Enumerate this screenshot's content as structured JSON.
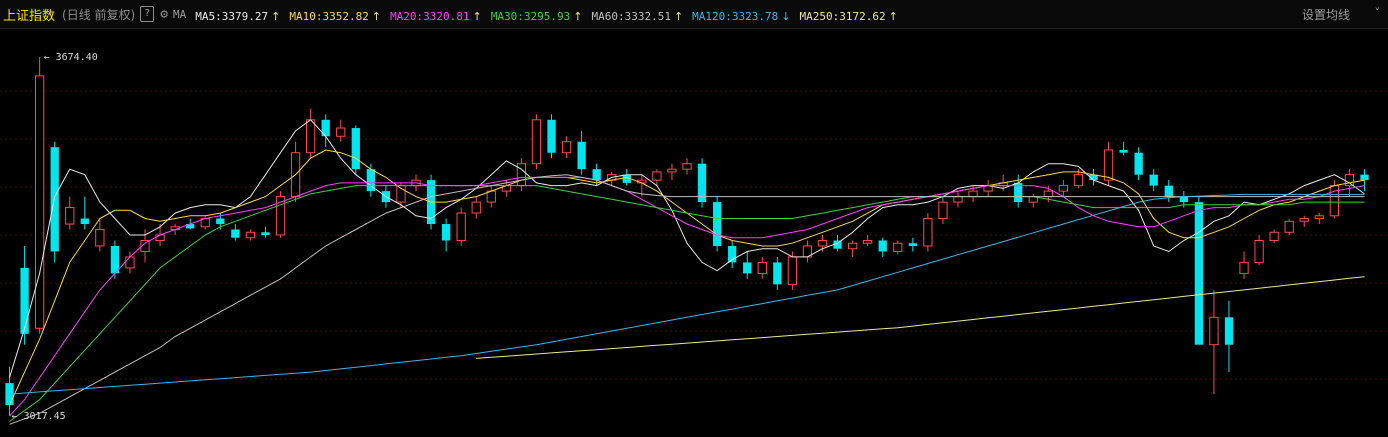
{
  "header": {
    "title": "上证指数",
    "period": "(日线 前复权)",
    "help_label": "?",
    "ma_label": "MA",
    "settings_label": "设置均线",
    "chevron": "˅"
  },
  "moving_averages": [
    {
      "label": "MA5:3379.27",
      "arrow": "↑",
      "color": "#e8e8e8"
    },
    {
      "label": "MA10:3352.82",
      "arrow": "↑",
      "color": "#ffd83a"
    },
    {
      "label": "MA20:3320.81",
      "arrow": "↑",
      "color": "#ff3cff"
    },
    {
      "label": "MA30:3295.93",
      "arrow": "↑",
      "color": "#3cd23c"
    },
    {
      "label": "MA60:3332.51",
      "arrow": "↑",
      "color": "#bfbfbf"
    },
    {
      "label": "MA120:3323.78",
      "arrow": "↓",
      "color": "#3cb4e6"
    },
    {
      "label": "MA250:3172.62",
      "arrow": "↑",
      "color": "#e8e890"
    }
  ],
  "chart_data": {
    "type": "candlestick",
    "colors": {
      "up": "#ff4a4a",
      "down": "#00e5ee"
    },
    "annotations": {
      "high": "3674.40",
      "low": "3017.45"
    },
    "series": [
      {
        "name": "MA5",
        "values": [
          3090,
          3180,
          3280,
          3420,
          3470,
          3460,
          3410,
          3380,
          3350,
          3350,
          3365,
          3390,
          3400,
          3405,
          3405,
          3400,
          3420,
          3460,
          3500,
          3540,
          3560,
          3530,
          3490,
          3460,
          3440,
          3420,
          3405,
          3385,
          3380,
          3400,
          3415,
          3435,
          3460,
          3485,
          3470,
          3445,
          3440,
          3440,
          3445,
          3440,
          3455,
          3460,
          3460,
          3440,
          3395,
          3335,
          3300,
          3285,
          3305,
          3320,
          3325,
          3325,
          3310,
          3310,
          3325,
          3335,
          3355,
          3380,
          3400,
          3405,
          3405,
          3410,
          3420,
          3435,
          3440,
          3440,
          3435,
          3445,
          3465,
          3480,
          3480,
          3475,
          3450,
          3440,
          3430,
          3395,
          3330,
          3320,
          3340,
          3355,
          3375,
          3385,
          3410,
          3405,
          3415,
          3425,
          3440,
          3450,
          3460,
          3445,
          3425
        ]
      },
      {
        "name": "MA10",
        "values": [
          3040,
          3100,
          3160,
          3230,
          3300,
          3340,
          3380,
          3395,
          3395,
          3380,
          3375,
          3380,
          3385,
          3385,
          3390,
          3400,
          3410,
          3420,
          3440,
          3460,
          3490,
          3505,
          3500,
          3490,
          3470,
          3455,
          3435,
          3420,
          3410,
          3410,
          3415,
          3420,
          3430,
          3440,
          3450,
          3455,
          3455,
          3455,
          3450,
          3445,
          3450,
          3455,
          3445,
          3430,
          3410,
          3390,
          3370,
          3350,
          3340,
          3335,
          3330,
          3330,
          3335,
          3345,
          3355,
          3365,
          3375,
          3390,
          3405,
          3410,
          3415,
          3420,
          3425,
          3430,
          3435,
          3440,
          3445,
          3450,
          3455,
          3460,
          3465,
          3465,
          3460,
          3455,
          3445,
          3425,
          3380,
          3355,
          3345,
          3345,
          3355,
          3365,
          3380,
          3395,
          3405,
          3410,
          3420,
          3430,
          3440,
          3445,
          3450
        ]
      },
      {
        "name": "MA20",
        "values": [
          3020,
          3050,
          3090,
          3130,
          3170,
          3210,
          3250,
          3280,
          3310,
          3335,
          3350,
          3360,
          3370,
          3380,
          3385,
          3390,
          3395,
          3400,
          3410,
          3420,
          3430,
          3440,
          3445,
          3445,
          3445,
          3445,
          3445,
          3445,
          3440,
          3440,
          3440,
          3440,
          3445,
          3450,
          3455,
          3455,
          3455,
          3455,
          3455,
          3450,
          3440,
          3430,
          3415,
          3400,
          3385,
          3370,
          3360,
          3350,
          3345,
          3345,
          3345,
          3350,
          3355,
          3360,
          3370,
          3380,
          3390,
          3400,
          3405,
          3410,
          3415,
          3420,
          3425,
          3430,
          3435,
          3440,
          3440,
          3440,
          3440,
          3435,
          3420,
          3400,
          3385,
          3375,
          3370,
          3365,
          3365,
          3375,
          3385,
          3395,
          3400,
          3400,
          3405,
          3405,
          3410,
          3415,
          3415,
          3420,
          3430,
          3435,
          3440
        ]
      },
      {
        "name": "MA30",
        "values": [
          3010,
          3030,
          3050,
          3080,
          3110,
          3140,
          3170,
          3200,
          3230,
          3260,
          3290,
          3310,
          3330,
          3350,
          3365,
          3375,
          3385,
          3395,
          3405,
          3415,
          3425,
          3430,
          3435,
          3440,
          3440,
          3440,
          3440,
          3440,
          3440,
          3440,
          3440,
          3440,
          3440,
          3440,
          3440,
          3440,
          3435,
          3430,
          3425,
          3420,
          3415,
          3410,
          3405,
          3400,
          3395,
          3390,
          3385,
          3380,
          3380,
          3380,
          3380,
          3380,
          3380,
          3385,
          3390,
          3395,
          3400,
          3405,
          3410,
          3415,
          3420,
          3420,
          3420,
          3420,
          3420,
          3420,
          3420,
          3420,
          3420,
          3415,
          3410,
          3405,
          3400,
          3400,
          3400,
          3400,
          3400,
          3400,
          3405,
          3405,
          3405,
          3405,
          3405,
          3405,
          3405,
          3405,
          3410,
          3410,
          3410,
          3410,
          3410
        ]
      },
      {
        "name": "MA60",
        "values": [
          3005,
          3015,
          3025,
          3040,
          3055,
          3070,
          3085,
          3100,
          3115,
          3130,
          3145,
          3165,
          3180,
          3195,
          3210,
          3225,
          3240,
          3255,
          3270,
          3290,
          3310,
          3330,
          3345,
          3360,
          3375,
          3390,
          3400,
          3410,
          3420,
          3425,
          3430,
          3435,
          3440,
          3445,
          3450,
          3455,
          3458,
          3460,
          3455,
          3450,
          3440,
          3430,
          3425,
          3422,
          3420,
          3420,
          3420,
          3420,
          3420,
          3420,
          3420,
          3420,
          3420,
          3420,
          3420,
          3420,
          3420,
          3420,
          3420,
          3420,
          3420,
          3420,
          3420,
          3420,
          3420,
          3420,
          3420,
          3420,
          3420,
          3420,
          3420,
          3420,
          3420,
          3420,
          3420,
          3420,
          3420,
          3420,
          3420,
          3420,
          3420,
          3420,
          3420,
          3420,
          3420,
          3420,
          3420,
          3420,
          3420,
          3420,
          3420
        ]
      },
      {
        "name": "MA120",
        "values": [
          3060,
          3062,
          3064,
          3066,
          3068,
          3070,
          3072,
          3074,
          3076,
          3078,
          3080,
          3082,
          3084,
          3086,
          3088,
          3090,
          3092,
          3094,
          3096,
          3098,
          3100,
          3103,
          3106,
          3109,
          3112,
          3115,
          3118,
          3121,
          3124,
          3127,
          3130,
          3134,
          3138,
          3142,
          3146,
          3150,
          3155,
          3160,
          3165,
          3170,
          3175,
          3180,
          3185,
          3190,
          3195,
          3200,
          3205,
          3210,
          3215,
          3220,
          3225,
          3230,
          3235,
          3240,
          3245,
          3250,
          3258,
          3266,
          3274,
          3282,
          3290,
          3298,
          3306,
          3314,
          3322,
          3330,
          3338,
          3346,
          3354,
          3362,
          3370,
          3378,
          3386,
          3394,
          3402,
          3410,
          3415,
          3418,
          3420,
          3421,
          3422,
          3423,
          3424,
          3424,
          3424,
          3424,
          3424,
          3424,
          3424,
          3424,
          3424
        ]
      },
      {
        "name": "MA250",
        "values": [
          null,
          null,
          null,
          null,
          null,
          null,
          null,
          null,
          null,
          null,
          null,
          null,
          null,
          null,
          null,
          null,
          null,
          null,
          null,
          null,
          null,
          null,
          null,
          null,
          null,
          null,
          null,
          null,
          null,
          null,
          null,
          3125,
          3127,
          3129,
          3131,
          3133,
          3135,
          3137,
          3139,
          3141,
          3143,
          3145,
          3147,
          3149,
          3151,
          3153,
          3155,
          3157,
          3159,
          3161,
          3163,
          3165,
          3167,
          3169,
          3171,
          3173,
          3175,
          3177,
          3179,
          3181,
          3184,
          3187,
          3190,
          3193,
          3196,
          3199,
          3202,
          3205,
          3208,
          3211,
          3214,
          3217,
          3220,
          3223,
          3226,
          3229,
          3232,
          3235,
          3238,
          3241,
          3244,
          3247,
          3250,
          3253,
          3256,
          3259,
          3262,
          3265,
          3268,
          3271,
          3274
        ]
      }
    ],
    "candles": [
      [
        3080,
        3110,
        3020,
        3040
      ],
      [
        3290,
        3330,
        3150,
        3170
      ],
      [
        3180,
        3674.4,
        3170,
        3640
      ],
      [
        3510,
        3520,
        3300,
        3320
      ],
      [
        3370,
        3420,
        3360,
        3400
      ],
      [
        3380,
        3420,
        3360,
        3370
      ],
      [
        3330,
        3380,
        3320,
        3360
      ],
      [
        3330,
        3340,
        3270,
        3280
      ],
      [
        3290,
        3320,
        3280,
        3310
      ],
      [
        3320,
        3360,
        3300,
        3340
      ],
      [
        3340,
        3370,
        3330,
        3350
      ],
      [
        3360,
        3370,
        3350,
        3365
      ],
      [
        3370,
        3380,
        3360,
        3362
      ],
      [
        3365,
        3385,
        3360,
        3380
      ],
      [
        3380,
        3390,
        3360,
        3370
      ],
      [
        3360,
        3370,
        3340,
        3345
      ],
      [
        3345,
        3360,
        3340,
        3355
      ],
      [
        3355,
        3365,
        3345,
        3350
      ],
      [
        3350,
        3430,
        3345,
        3420
      ],
      [
        3420,
        3520,
        3410,
        3500
      ],
      [
        3500,
        3580,
        3490,
        3560
      ],
      [
        3560,
        3570,
        3510,
        3530
      ],
      [
        3530,
        3560,
        3520,
        3545
      ],
      [
        3545,
        3550,
        3460,
        3470
      ],
      [
        3470,
        3480,
        3420,
        3430
      ],
      [
        3430,
        3440,
        3400,
        3410
      ],
      [
        3410,
        3445,
        3400,
        3440
      ],
      [
        3440,
        3460,
        3430,
        3450
      ],
      [
        3450,
        3460,
        3360,
        3370
      ],
      [
        3370,
        3380,
        3320,
        3340
      ],
      [
        3340,
        3400,
        3330,
        3390
      ],
      [
        3390,
        3420,
        3380,
        3410
      ],
      [
        3410,
        3440,
        3400,
        3430
      ],
      [
        3430,
        3450,
        3420,
        3440
      ],
      [
        3440,
        3490,
        3430,
        3480
      ],
      [
        3480,
        3570,
        3470,
        3560
      ],
      [
        3560,
        3570,
        3490,
        3500
      ],
      [
        3500,
        3530,
        3490,
        3520
      ],
      [
        3520,
        3540,
        3460,
        3470
      ],
      [
        3470,
        3480,
        3440,
        3450
      ],
      [
        3450,
        3465,
        3440,
        3460
      ],
      [
        3460,
        3470,
        3440,
        3445
      ],
      [
        3445,
        3460,
        3420,
        3450
      ],
      [
        3450,
        3470,
        3440,
        3465
      ],
      [
        3465,
        3480,
        3450,
        3470
      ],
      [
        3470,
        3490,
        3460,
        3480
      ],
      [
        3480,
        3490,
        3400,
        3410
      ],
      [
        3410,
        3420,
        3320,
        3330
      ],
      [
        3330,
        3340,
        3290,
        3300
      ],
      [
        3300,
        3320,
        3270,
        3280
      ],
      [
        3280,
        3310,
        3270,
        3300
      ],
      [
        3300,
        3310,
        3250,
        3260
      ],
      [
        3260,
        3320,
        3250,
        3310
      ],
      [
        3310,
        3340,
        3300,
        3330
      ],
      [
        3330,
        3350,
        3320,
        3340
      ],
      [
        3340,
        3350,
        3320,
        3325
      ],
      [
        3325,
        3340,
        3310,
        3335
      ],
      [
        3335,
        3350,
        3330,
        3340
      ],
      [
        3340,
        3345,
        3310,
        3320
      ],
      [
        3320,
        3340,
        3315,
        3335
      ],
      [
        3335,
        3345,
        3320,
        3330
      ],
      [
        3330,
        3390,
        3320,
        3380
      ],
      [
        3380,
        3420,
        3370,
        3410
      ],
      [
        3410,
        3430,
        3400,
        3420
      ],
      [
        3420,
        3440,
        3410,
        3430
      ],
      [
        3430,
        3450,
        3420,
        3440
      ],
      [
        3440,
        3460,
        3430,
        3445
      ],
      [
        3445,
        3460,
        3400,
        3410
      ],
      [
        3410,
        3425,
        3400,
        3420
      ],
      [
        3420,
        3440,
        3410,
        3430
      ],
      [
        3430,
        3450,
        3420,
        3440
      ],
      [
        3440,
        3470,
        3435,
        3460
      ],
      [
        3460,
        3470,
        3440,
        3450
      ],
      [
        3450,
        3520,
        3440,
        3505
      ],
      [
        3505,
        3520,
        3495,
        3500
      ],
      [
        3500,
        3510,
        3450,
        3460
      ],
      [
        3460,
        3470,
        3430,
        3440
      ],
      [
        3440,
        3450,
        3410,
        3420
      ],
      [
        3420,
        3430,
        3400,
        3410
      ],
      [
        3410,
        3420,
        3250,
        3150
      ],
      [
        3150,
        3250,
        3060,
        3200
      ],
      [
        3200,
        3230,
        3100,
        3150
      ],
      [
        3280,
        3320,
        3270,
        3300
      ],
      [
        3300,
        3350,
        3295,
        3340
      ],
      [
        3340,
        3360,
        3335,
        3355
      ],
      [
        3355,
        3380,
        3350,
        3375
      ],
      [
        3375,
        3385,
        3365,
        3380
      ],
      [
        3380,
        3390,
        3370,
        3385
      ],
      [
        3385,
        3450,
        3380,
        3440
      ],
      [
        3440,
        3470,
        3420,
        3460
      ],
      [
        3460,
        3470,
        3430,
        3450
      ]
    ],
    "ylim": [
      3000,
      3700
    ]
  }
}
